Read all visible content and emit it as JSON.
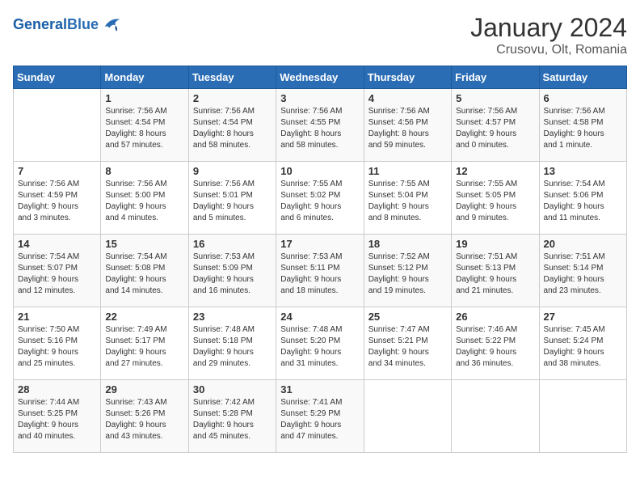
{
  "header": {
    "logo_text_general": "General",
    "logo_text_blue": "Blue",
    "title": "January 2024",
    "subtitle": "Crusovu, Olt, Romania"
  },
  "calendar": {
    "days_of_week": [
      "Sunday",
      "Monday",
      "Tuesday",
      "Wednesday",
      "Thursday",
      "Friday",
      "Saturday"
    ],
    "weeks": [
      [
        {
          "day": "",
          "info": ""
        },
        {
          "day": "1",
          "info": "Sunrise: 7:56 AM\nSunset: 4:54 PM\nDaylight: 8 hours\nand 57 minutes."
        },
        {
          "day": "2",
          "info": "Sunrise: 7:56 AM\nSunset: 4:54 PM\nDaylight: 8 hours\nand 58 minutes."
        },
        {
          "day": "3",
          "info": "Sunrise: 7:56 AM\nSunset: 4:55 PM\nDaylight: 8 hours\nand 58 minutes."
        },
        {
          "day": "4",
          "info": "Sunrise: 7:56 AM\nSunset: 4:56 PM\nDaylight: 8 hours\nand 59 minutes."
        },
        {
          "day": "5",
          "info": "Sunrise: 7:56 AM\nSunset: 4:57 PM\nDaylight: 9 hours\nand 0 minutes."
        },
        {
          "day": "6",
          "info": "Sunrise: 7:56 AM\nSunset: 4:58 PM\nDaylight: 9 hours\nand 1 minute."
        }
      ],
      [
        {
          "day": "7",
          "info": "Sunrise: 7:56 AM\nSunset: 4:59 PM\nDaylight: 9 hours\nand 3 minutes."
        },
        {
          "day": "8",
          "info": "Sunrise: 7:56 AM\nSunset: 5:00 PM\nDaylight: 9 hours\nand 4 minutes."
        },
        {
          "day": "9",
          "info": "Sunrise: 7:56 AM\nSunset: 5:01 PM\nDaylight: 9 hours\nand 5 minutes."
        },
        {
          "day": "10",
          "info": "Sunrise: 7:55 AM\nSunset: 5:02 PM\nDaylight: 9 hours\nand 6 minutes."
        },
        {
          "day": "11",
          "info": "Sunrise: 7:55 AM\nSunset: 5:04 PM\nDaylight: 9 hours\nand 8 minutes."
        },
        {
          "day": "12",
          "info": "Sunrise: 7:55 AM\nSunset: 5:05 PM\nDaylight: 9 hours\nand 9 minutes."
        },
        {
          "day": "13",
          "info": "Sunrise: 7:54 AM\nSunset: 5:06 PM\nDaylight: 9 hours\nand 11 minutes."
        }
      ],
      [
        {
          "day": "14",
          "info": "Sunrise: 7:54 AM\nSunset: 5:07 PM\nDaylight: 9 hours\nand 12 minutes."
        },
        {
          "day": "15",
          "info": "Sunrise: 7:54 AM\nSunset: 5:08 PM\nDaylight: 9 hours\nand 14 minutes."
        },
        {
          "day": "16",
          "info": "Sunrise: 7:53 AM\nSunset: 5:09 PM\nDaylight: 9 hours\nand 16 minutes."
        },
        {
          "day": "17",
          "info": "Sunrise: 7:53 AM\nSunset: 5:11 PM\nDaylight: 9 hours\nand 18 minutes."
        },
        {
          "day": "18",
          "info": "Sunrise: 7:52 AM\nSunset: 5:12 PM\nDaylight: 9 hours\nand 19 minutes."
        },
        {
          "day": "19",
          "info": "Sunrise: 7:51 AM\nSunset: 5:13 PM\nDaylight: 9 hours\nand 21 minutes."
        },
        {
          "day": "20",
          "info": "Sunrise: 7:51 AM\nSunset: 5:14 PM\nDaylight: 9 hours\nand 23 minutes."
        }
      ],
      [
        {
          "day": "21",
          "info": "Sunrise: 7:50 AM\nSunset: 5:16 PM\nDaylight: 9 hours\nand 25 minutes."
        },
        {
          "day": "22",
          "info": "Sunrise: 7:49 AM\nSunset: 5:17 PM\nDaylight: 9 hours\nand 27 minutes."
        },
        {
          "day": "23",
          "info": "Sunrise: 7:48 AM\nSunset: 5:18 PM\nDaylight: 9 hours\nand 29 minutes."
        },
        {
          "day": "24",
          "info": "Sunrise: 7:48 AM\nSunset: 5:20 PM\nDaylight: 9 hours\nand 31 minutes."
        },
        {
          "day": "25",
          "info": "Sunrise: 7:47 AM\nSunset: 5:21 PM\nDaylight: 9 hours\nand 34 minutes."
        },
        {
          "day": "26",
          "info": "Sunrise: 7:46 AM\nSunset: 5:22 PM\nDaylight: 9 hours\nand 36 minutes."
        },
        {
          "day": "27",
          "info": "Sunrise: 7:45 AM\nSunset: 5:24 PM\nDaylight: 9 hours\nand 38 minutes."
        }
      ],
      [
        {
          "day": "28",
          "info": "Sunrise: 7:44 AM\nSunset: 5:25 PM\nDaylight: 9 hours\nand 40 minutes."
        },
        {
          "day": "29",
          "info": "Sunrise: 7:43 AM\nSunset: 5:26 PM\nDaylight: 9 hours\nand 43 minutes."
        },
        {
          "day": "30",
          "info": "Sunrise: 7:42 AM\nSunset: 5:28 PM\nDaylight: 9 hours\nand 45 minutes."
        },
        {
          "day": "31",
          "info": "Sunrise: 7:41 AM\nSunset: 5:29 PM\nDaylight: 9 hours\nand 47 minutes."
        },
        {
          "day": "",
          "info": ""
        },
        {
          "day": "",
          "info": ""
        },
        {
          "day": "",
          "info": ""
        }
      ]
    ]
  }
}
